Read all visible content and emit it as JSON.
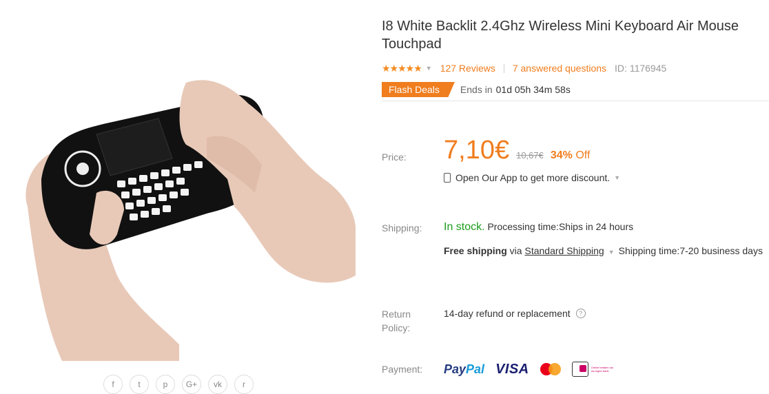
{
  "product": {
    "title": "I8 White Backlit 2.4Ghz Wireless Mini Keyboard Air Mouse Touchpad",
    "rating_stars": "★★★★★",
    "rating_value": 5,
    "reviews": "127 Reviews",
    "questions": "7 answered questions",
    "id": "ID: 1176945"
  },
  "flash": {
    "badge": "Flash Deals",
    "ends_label": "Ends in",
    "countdown": "01d 05h 34m 58s"
  },
  "price": {
    "label": "Price:",
    "current": "7,10€",
    "old": "10,67€",
    "discount_pct": "34%",
    "discount_suffix": " Off",
    "app_text": "Open Our App to get more discount."
  },
  "shipping": {
    "label": "Shipping:",
    "status": "In stock.",
    "processing": " Processing time:Ships in 24 hours",
    "free": "Free shipping",
    "via": " via ",
    "method": "Standard Shipping",
    "time": "Shipping time:7-20 business days"
  },
  "return": {
    "label_line1": "Return",
    "label_line2": "Policy:",
    "text": "14-day refund or replacement"
  },
  "payment": {
    "label": "Payment:",
    "paypal_a": "Pay",
    "paypal_b": "Pal",
    "visa": "VISA",
    "ideal_text": "Online betalen via uw eigen bank"
  },
  "share_icons": [
    "facebook-icon",
    "twitter-icon",
    "pinterest-icon",
    "google-plus-icon",
    "vk-icon",
    "reddit-icon"
  ],
  "colors": {
    "accent": "#f07d1e",
    "stock": "#1a9e1a"
  }
}
